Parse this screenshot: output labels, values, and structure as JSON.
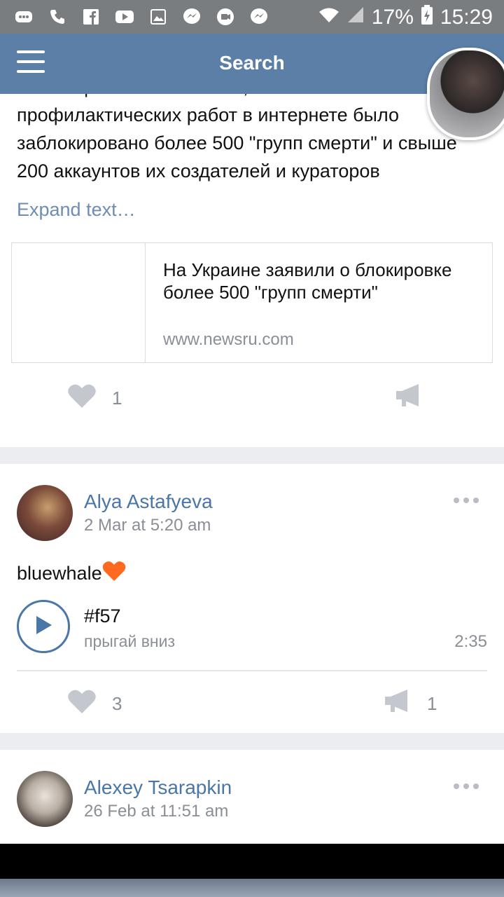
{
  "status_bar": {
    "battery": "17%",
    "time": "15:29",
    "icons": [
      "chat-icon",
      "phone-icon",
      "facebook-icon",
      "youtube-icon",
      "gallery-icon",
      "messenger-icon",
      "viber-icon",
      "messenger-icon",
      "wifi-icon",
      "signal-icon",
      "battery-icon"
    ]
  },
  "app_bar": {
    "title": "Search",
    "menu_icon": "hamburger-icon"
  },
  "posts": [
    {
      "text_clipped_top": "В полиции Киева заявили, что после",
      "text": "профилактических работ в интернете было заблокировано более 500 \"групп смерти\" и свыше 200 аккаунтов их создателей и кураторов",
      "expand": "Expand text…",
      "link": {
        "title": "На Украине заявили о блокировке более 500 \"групп смерти\"",
        "url": "www.newsru.com"
      },
      "likes": "1",
      "reposts": ""
    },
    {
      "author": "Alya Astafyeva",
      "date": "2 Mar at 5:20 am",
      "text": "bluewhale",
      "audio": {
        "title": "#f57",
        "artist": "прыгай вниз",
        "duration": "2:35"
      },
      "likes": "3",
      "reposts": "1"
    },
    {
      "author": "Alexey Tsarapkin",
      "date": "26 Feb at 11:51 am"
    }
  ],
  "colors": {
    "app_bar": "#5b7fa6",
    "link": "#4a76a8",
    "muted": "#8a8f96"
  }
}
